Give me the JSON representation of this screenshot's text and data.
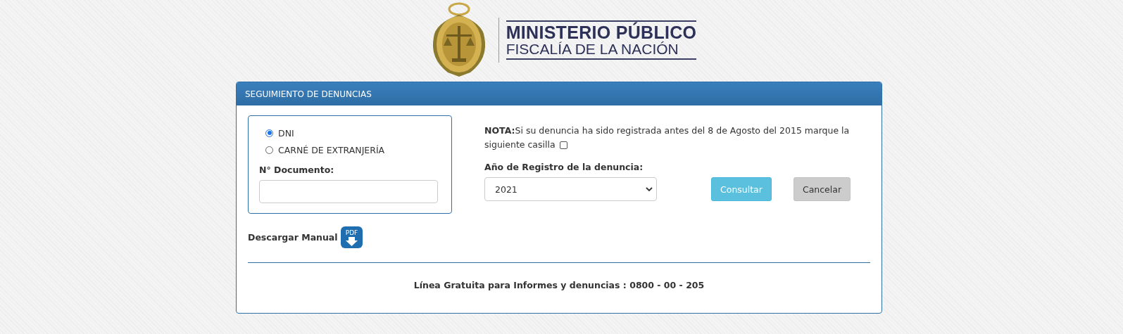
{
  "logo": {
    "line_1": "MINISTERIO PÚBLICO",
    "line_2": "FISCALÍA DE LA NACIÓN"
  },
  "panel": {
    "title": "SEGUIMIENTO DE DENUNCIAS"
  },
  "document_types": [
    {
      "label": "DNI",
      "selected": true
    },
    {
      "label": "CARNÉ DE EXTRANJERÍA",
      "selected": false
    }
  ],
  "document_number": {
    "label": "N° Documento:"
  },
  "note": {
    "lines": [
      "**NOTA:**Si su denuncia ha sido registrada antes del 8 de Agosto del 2015 marque la",
      "siguiente casilla"
    ],
    "checked": false
  },
  "year": {
    "label": "Año de Registro de la denuncia:",
    "value": "2021"
  },
  "buttons": [
    {
      "label": "Consultar",
      "kind": "primary"
    },
    {
      "label": "Cancelar",
      "kind": "secondary"
    }
  ],
  "manual": {
    "label": "Descargar Manual",
    "icon_text": "PDF"
  },
  "footer": "Línea Gratuita para Informes y denuncias : 0800 - 00 - 205"
}
